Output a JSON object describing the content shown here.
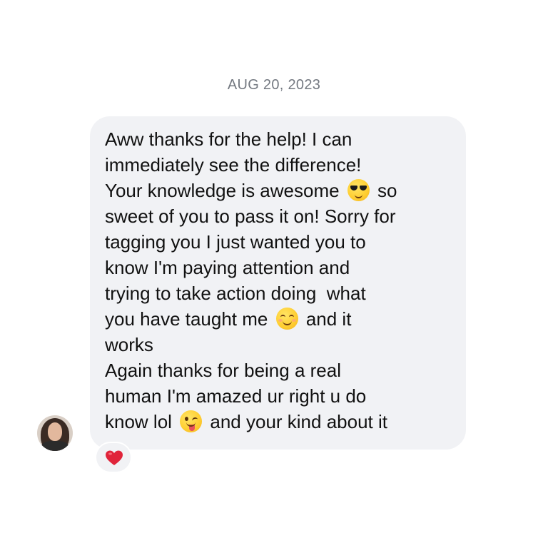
{
  "thread": {
    "date_header": "AUG 20, 2023"
  },
  "message": {
    "lines": [
      [
        {
          "text": "Aww thanks for the help! I can"
        }
      ],
      [
        {
          "text": "immediately see the difference!"
        }
      ],
      [
        {
          "text": "Your knowledge is awesome "
        },
        {
          "emoji": "smiling-face-with-sunglasses-icon"
        },
        {
          "text": " so"
        }
      ],
      [
        {
          "text": "sweet of you to pass it on! Sorry for"
        }
      ],
      [
        {
          "text": "tagging you I just wanted you to"
        }
      ],
      [
        {
          "text": "know I'm paying attention and"
        }
      ],
      [
        {
          "text": "trying to take action doing  what"
        }
      ],
      [
        {
          "text": "you have taught me "
        },
        {
          "emoji": "smiling-face-with-smiling-eyes-icon"
        },
        {
          "text": " and it"
        }
      ],
      [
        {
          "text": "works"
        }
      ],
      [
        {
          "text": "Again thanks for being a real"
        }
      ],
      [
        {
          "text": "human I'm amazed ur right u do"
        }
      ],
      [
        {
          "text": "know lol "
        },
        {
          "emoji": "winking-face-with-tongue-icon"
        },
        {
          "text": " and your kind about it"
        }
      ]
    ]
  },
  "reaction": {
    "icon": "red-heart-icon",
    "color": "#e0243a"
  },
  "colors": {
    "bubble_background": "#f1f2f5",
    "date_text": "#737880",
    "message_text": "#111111"
  }
}
